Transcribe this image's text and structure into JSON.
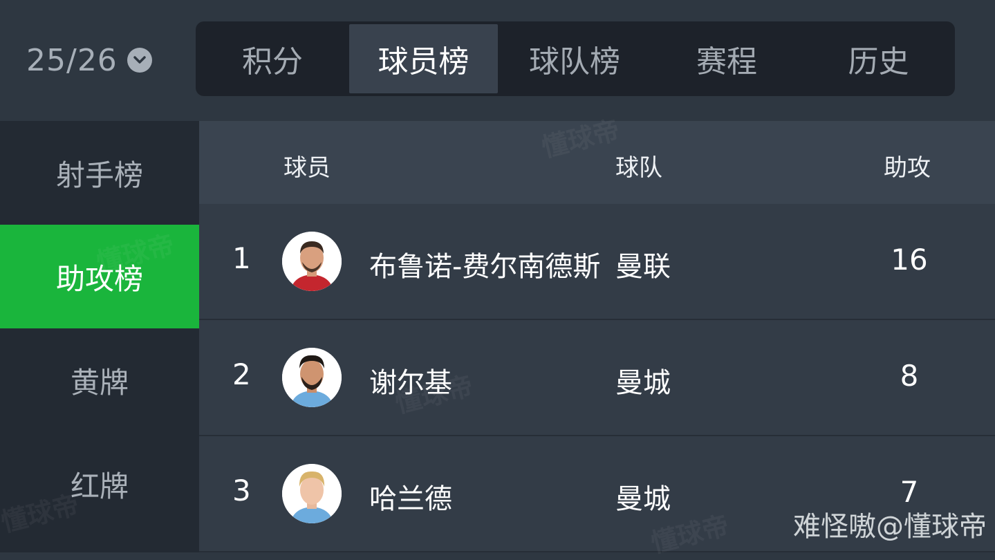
{
  "season": {
    "label": "25/26",
    "dropdown_icon": "chevron-down-circle-icon"
  },
  "tabs": [
    {
      "label": "积分",
      "active": false
    },
    {
      "label": "球员榜",
      "active": true
    },
    {
      "label": "球队榜",
      "active": false
    },
    {
      "label": "赛程",
      "active": false
    },
    {
      "label": "历史",
      "active": false
    }
  ],
  "sidebar": {
    "items": [
      {
        "label": "射手榜",
        "active": false
      },
      {
        "label": "助攻榜",
        "active": true
      },
      {
        "label": "黄牌",
        "active": false
      },
      {
        "label": "红牌",
        "active": false
      }
    ]
  },
  "table": {
    "headers": {
      "player": "球员",
      "team": "球队",
      "assists": "助攻"
    },
    "rows": [
      {
        "rank": "1",
        "player": "布鲁诺-费尔南德斯",
        "team": "曼联",
        "assists": "16"
      },
      {
        "rank": "2",
        "player": "谢尔基",
        "team": "曼城",
        "assists": "8"
      },
      {
        "rank": "3",
        "player": "哈兰德",
        "team": "曼城",
        "assists": "7"
      }
    ]
  },
  "watermark": {
    "brand": "懂球帝"
  },
  "credit": "难怪嗷@懂球帝",
  "colors": {
    "accent_green": "#1ab53c",
    "background": "#2e3741",
    "sidebar": "#232a33",
    "tab_bar": "#1d222a"
  }
}
